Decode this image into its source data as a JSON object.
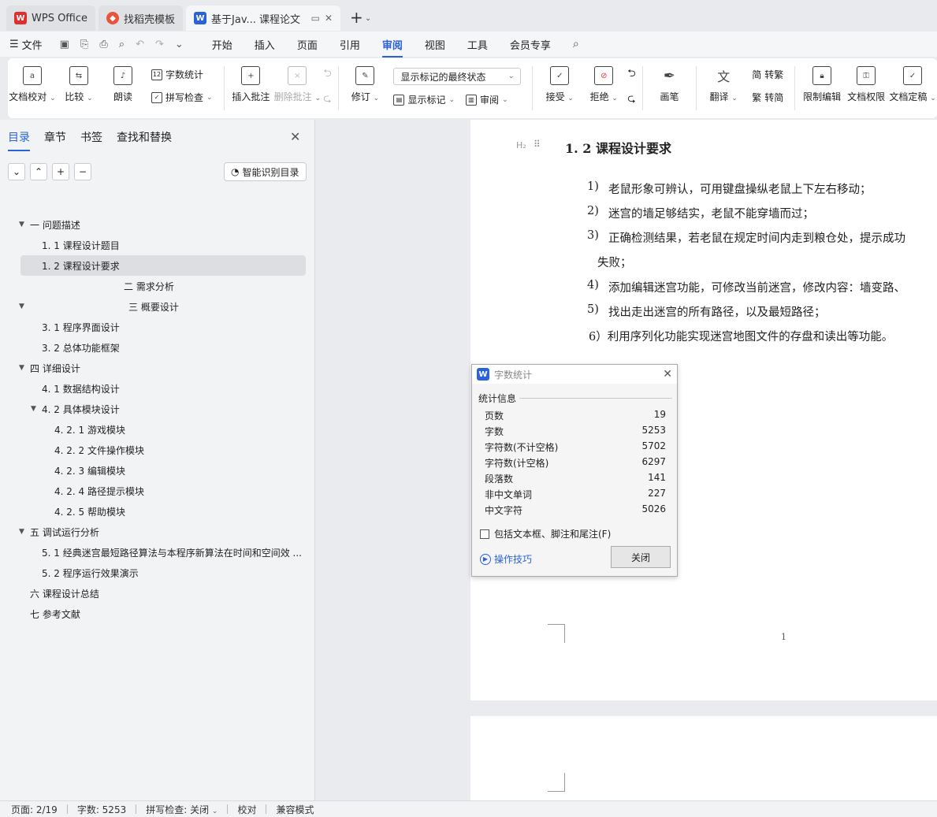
{
  "tabs": [
    {
      "label": "WPS Office",
      "icon": "wps-logo-icon"
    },
    {
      "label": "找稻壳模板",
      "icon": "daoke-logo-icon"
    },
    {
      "label": "基于Jav... 课程论文",
      "icon": "writer-logo-icon"
    }
  ],
  "menubar": {
    "file": "文件",
    "items": [
      "开始",
      "插入",
      "页面",
      "引用",
      "审阅",
      "视图",
      "工具",
      "会员专享"
    ],
    "active": "审阅"
  },
  "ribbon": {
    "doc_check": "文档校对",
    "compare": "比较",
    "read_aloud": "朗读",
    "word_count": "字数统计",
    "spell_check": "拼写检查",
    "insert_comment": "插入批注",
    "delete_comment": "删除批注",
    "revise": "修订",
    "markup_dropdown": "显示标记的最终状态",
    "show_markup": "显示标记",
    "review": "审阅",
    "accept": "接受",
    "reject": "拒绝",
    "pen": "画笔",
    "translate": "翻译",
    "to_traditional": "转繁",
    "to_simplified": "转简",
    "restrict_edit": "限制编辑",
    "doc_permission": "文档权限",
    "doc_finalize": "文档定稿"
  },
  "leftpanel": {
    "tabs": [
      "目录",
      "章节",
      "书签",
      "查找和替换"
    ],
    "smart_toc": "智能识别目录",
    "toc": [
      {
        "text": "一 问题描述",
        "expanded": true
      },
      {
        "text": "1. 1 课程设计题目"
      },
      {
        "text": "1. 2 课程设计要求",
        "selected": true
      },
      {
        "text": "二 需求分析"
      },
      {
        "text": "三 概要设计",
        "expanded": true
      },
      {
        "text": "3. 1 程序界面设计"
      },
      {
        "text": "3. 2 总体功能框架"
      },
      {
        "text": "四 详细设计",
        "expanded": true
      },
      {
        "text": "4. 1 数据结构设计"
      },
      {
        "text": "4. 2 具体模块设计",
        "expanded": true
      },
      {
        "text": "4. 2. 1 游戏模块"
      },
      {
        "text": "4. 2. 2 文件操作模块"
      },
      {
        "text": "4. 2. 3 编辑模块"
      },
      {
        "text": "4. 2. 4 路径提示模块"
      },
      {
        "text": "4. 2. 5 帮助模块"
      },
      {
        "text": "五 调试运行分析",
        "expanded": true
      },
      {
        "text": "5. 1 经典迷宫最短路径算法与本程序新算法在时间和空间效 ..."
      },
      {
        "text": "5. 2 程序运行效果演示"
      },
      {
        "text": "六 课程设计总结"
      },
      {
        "text": "七 参考文献"
      }
    ]
  },
  "document": {
    "heading_marker": "H₂",
    "heading": "1. 2 课程设计要求",
    "items": [
      {
        "num": "1)",
        "text": "老鼠形象可辨认，可用键盘操纵老鼠上下左右移动；"
      },
      {
        "num": "2)",
        "text": "迷宫的墙足够结实，老鼠不能穿墙而过；"
      },
      {
        "num": "3)",
        "text": "正确检测结果，若老鼠在规定时间内走到粮仓处，提示成功"
      },
      {
        "num": "",
        "text": "失败；"
      },
      {
        "num": "4)",
        "text": "添加编辑迷宫功能，可修改当前迷宫，修改内容：墙变路、"
      },
      {
        "num": "5)",
        "text": "找出走出迷宫的所有路径，以及最短路径；"
      },
      {
        "num": "",
        "text": "6）利用序列化功能实现迷宫地图文件的存盘和读出等功能。"
      }
    ],
    "page_number": "1"
  },
  "dialog": {
    "title": "字数统计",
    "section": "统计信息",
    "stats": [
      {
        "label": "页数",
        "value": "19"
      },
      {
        "label": "字数",
        "value": "5253"
      },
      {
        "label": "字符数(不计空格)",
        "value": "5702"
      },
      {
        "label": "字符数(计空格)",
        "value": "6297"
      },
      {
        "label": "段落数",
        "value": "141"
      },
      {
        "label": "非中文单词",
        "value": "227"
      },
      {
        "label": "中文字符",
        "value": "5026"
      }
    ],
    "include_label": "包括文本框、脚注和尾注(F)",
    "tips": "操作技巧",
    "close_button": "关闭"
  },
  "statusbar": {
    "page": "页面: 2/19",
    "words": "字数: 5253",
    "spell": "拼写检查: 关闭",
    "proofread": "校对",
    "compat": "兼容模式"
  },
  "colors": {
    "accent": "#2a63d9"
  }
}
